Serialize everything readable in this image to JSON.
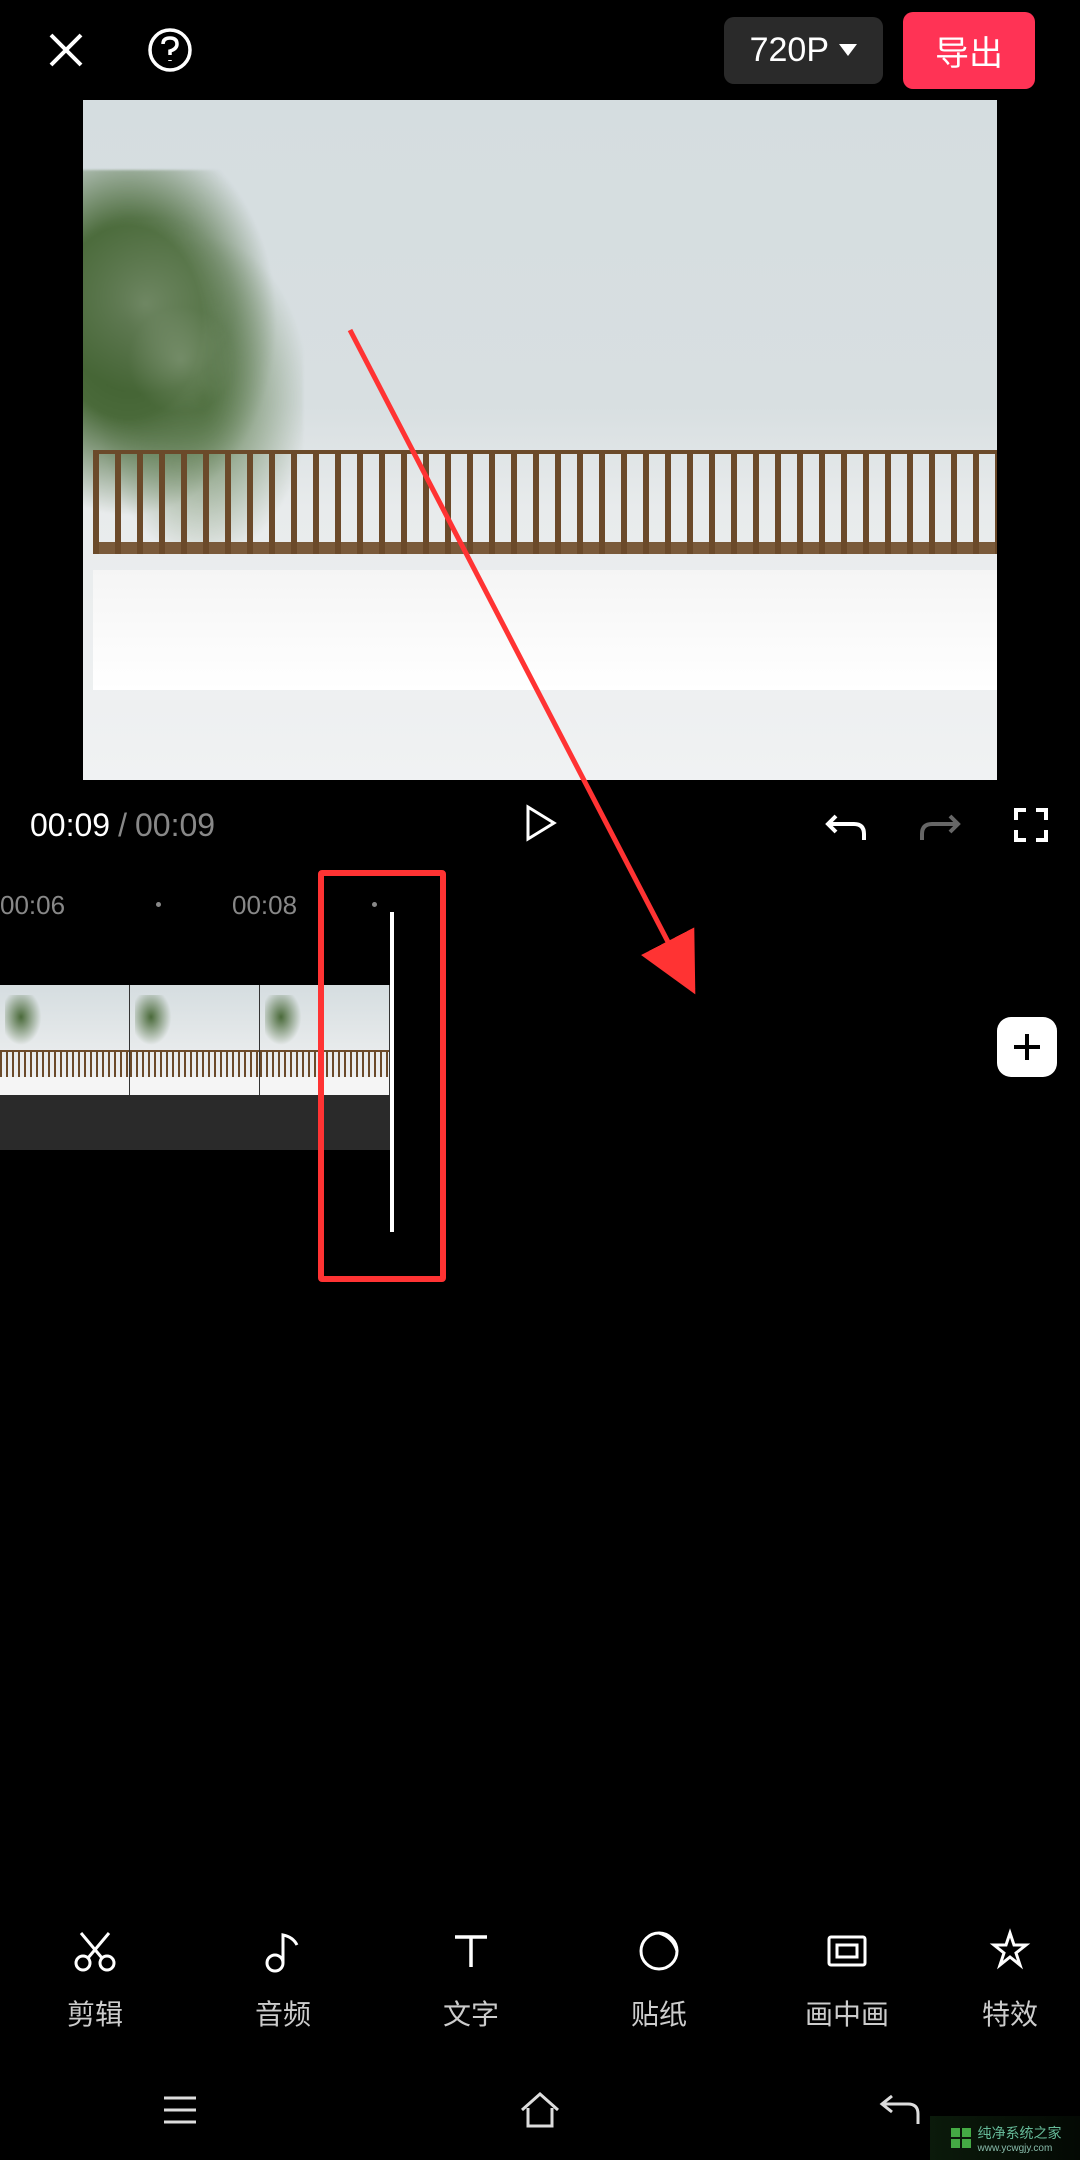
{
  "header": {
    "resolution": "720P",
    "export_label": "导出"
  },
  "controls": {
    "current_time": "00:09",
    "separator": "/",
    "total_time": "00:09"
  },
  "timeline": {
    "ruler_labels": [
      "00:06",
      "00:08"
    ],
    "add_label": "+"
  },
  "toolbar": [
    {
      "icon": "scissors",
      "label": "剪辑"
    },
    {
      "icon": "music-note",
      "label": "音频"
    },
    {
      "icon": "text",
      "label": "文字"
    },
    {
      "icon": "sticker",
      "label": "贴纸"
    },
    {
      "icon": "pip",
      "label": "画中画"
    },
    {
      "icon": "effects",
      "label": "特效"
    }
  ],
  "watermark": {
    "text": "纯净系统之家",
    "url": "www.ycwgjy.com"
  }
}
